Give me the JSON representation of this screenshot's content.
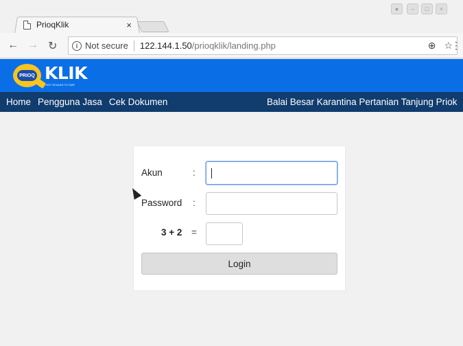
{
  "browser": {
    "tab_title": "PrioqKlik",
    "tab_close": "×",
    "security_label": "Not secure",
    "url_host": "122.144.1.50",
    "url_path": "/prioqklik/landing.php",
    "icons": [
      "back-icon",
      "forward-icon",
      "reload-icon",
      "info-icon",
      "zoom-icon",
      "star-icon",
      "menu-icon"
    ]
  },
  "header": {
    "logo_badge": "PRIOQ",
    "logo_text": "KLIK",
    "logo_tagline": "NOT SCALED TO SIZE",
    "brand_color": "#0a6fe6",
    "nav_color": "#103c6e"
  },
  "nav": {
    "items": [
      "Home",
      "Pengguna Jasa",
      "Cek Dokumen"
    ],
    "right_text": "Balai Besar Karantina Pertanian Tanjung Priok"
  },
  "login": {
    "akun_label": "Akun",
    "password_label": "Password",
    "colon": ":",
    "captcha_question": "3 + 2",
    "captcha_equals": "=",
    "akun_value": "",
    "password_value": "",
    "captcha_value": "",
    "button_label": "Login"
  }
}
